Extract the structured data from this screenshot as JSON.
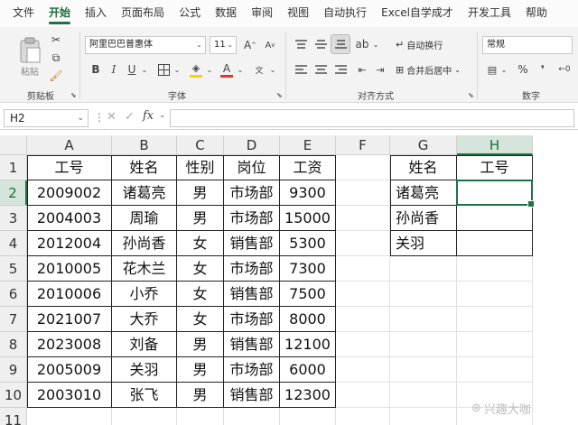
{
  "menu": [
    "文件",
    "开始",
    "插入",
    "页面布局",
    "公式",
    "数据",
    "审阅",
    "视图",
    "自动执行",
    "Excel自学成才",
    "开发工具",
    "帮助"
  ],
  "active_menu": "开始",
  "ribbon": {
    "paste_label": "粘贴",
    "clipboard_label": "剪贴板",
    "font_name": "阿里巴巴普惠体",
    "font_size": "11",
    "font_label": "字体",
    "align_label": "对齐方式",
    "wrap_label": "自动换行",
    "merge_label": "合并后居中",
    "number_format": "常规",
    "number_label": "数字"
  },
  "formula_bar": {
    "name_box": "H2",
    "formula": ""
  },
  "columns": [
    "A",
    "B",
    "C",
    "D",
    "E",
    "F",
    "G",
    "H"
  ],
  "rows": [
    "1",
    "2",
    "3",
    "4",
    "5",
    "6",
    "7",
    "8",
    "9",
    "10",
    "11"
  ],
  "selected_column": "H",
  "selected_row": "2",
  "table": [
    [
      "工号",
      "姓名",
      "性别",
      "岗位",
      "工资"
    ],
    [
      "2009002",
      "诸葛亮",
      "男",
      "市场部",
      "9300"
    ],
    [
      "2004003",
      "周瑜",
      "男",
      "市场部",
      "15000"
    ],
    [
      "2012004",
      "孙尚香",
      "女",
      "销售部",
      "5300"
    ],
    [
      "2010005",
      "花木兰",
      "女",
      "市场部",
      "7300"
    ],
    [
      "2010006",
      "小乔",
      "女",
      "销售部",
      "7500"
    ],
    [
      "2021007",
      "大乔",
      "女",
      "市场部",
      "8000"
    ],
    [
      "2023008",
      "刘备",
      "男",
      "销售部",
      "12100"
    ],
    [
      "2005009",
      "关羽",
      "男",
      "市场部",
      "6000"
    ],
    [
      "2003010",
      "张飞",
      "男",
      "销售部",
      "12300"
    ]
  ],
  "lookup": [
    [
      "姓名",
      "工号"
    ],
    [
      "诸葛亮",
      ""
    ],
    [
      "孙尚香",
      ""
    ],
    [
      "关羽",
      ""
    ]
  ],
  "watermark": "兴趣大咖",
  "colors": {
    "accent": "#1e7145",
    "font_color_bar": "#e8352c",
    "fill_color_bar": "#f5d10c"
  }
}
